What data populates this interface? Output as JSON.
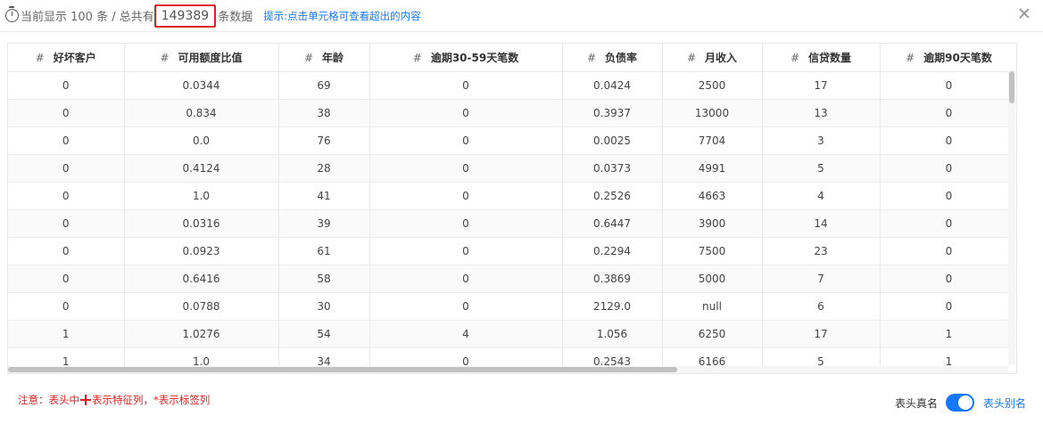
{
  "header": {
    "summary_prefix": "当前显示 100 条 / 总共有",
    "total": "149389",
    "summary_suffix": "条数据",
    "hint": "提示:点击单元格可查看超出的内容"
  },
  "table": {
    "columns": [
      "好坏客户",
      "可用额度比值",
      "年龄",
      "逾期30-59天笔数",
      "负债率",
      "月收入",
      "信贷数量",
      "逾期90天笔数"
    ],
    "column_prefix": "#",
    "rows": [
      [
        "0",
        "0.0344",
        "69",
        "0",
        "0.0424",
        "2500",
        "17",
        "0"
      ],
      [
        "0",
        "0.834",
        "38",
        "0",
        "0.3937",
        "13000",
        "13",
        "0"
      ],
      [
        "0",
        "0.0",
        "76",
        "0",
        "0.0025",
        "7704",
        "3",
        "0"
      ],
      [
        "0",
        "0.4124",
        "28",
        "0",
        "0.0373",
        "4991",
        "5",
        "0"
      ],
      [
        "0",
        "1.0",
        "41",
        "0",
        "0.2526",
        "4663",
        "4",
        "0"
      ],
      [
        "0",
        "0.0316",
        "39",
        "0",
        "0.6447",
        "3900",
        "14",
        "0"
      ],
      [
        "0",
        "0.0923",
        "61",
        "0",
        "0.2294",
        "7500",
        "23",
        "0"
      ],
      [
        "0",
        "0.6416",
        "58",
        "0",
        "0.3869",
        "5000",
        "7",
        "0"
      ],
      [
        "0",
        "0.0788",
        "30",
        "0",
        "2129.0",
        "null",
        "6",
        "0"
      ],
      [
        "1",
        "1.0276",
        "54",
        "4",
        "1.056",
        "6250",
        "17",
        "1"
      ],
      [
        "1",
        "1.0",
        "34",
        "0",
        "0.2543",
        "6166",
        "5",
        "1"
      ]
    ]
  },
  "footer": {
    "note_prefix": "注意：表头中",
    "note_suffix": "表示特征列，*表示标签列",
    "switch_left_label": "表头真名",
    "switch_right_label": "表头别名"
  },
  "colors": {
    "accent": "#1677ff",
    "warning": "#e02020"
  }
}
